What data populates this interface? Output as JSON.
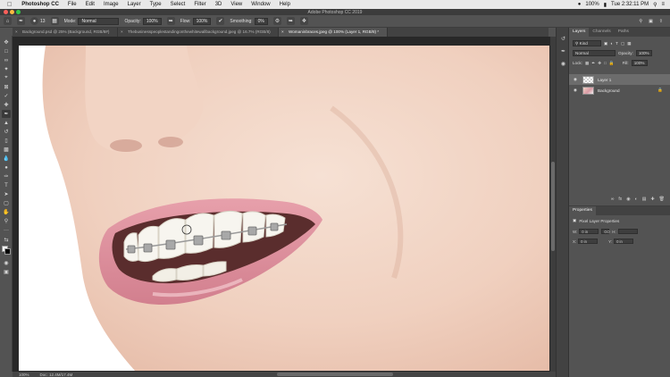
{
  "menubar": {
    "apple": "",
    "app_name": "Photoshop CC",
    "items": [
      "File",
      "Edit",
      "Image",
      "Layer",
      "Type",
      "Select",
      "Filter",
      "3D",
      "View",
      "Window",
      "Help"
    ],
    "battery": "100%",
    "clock": "Tue 2:32:11 PM"
  },
  "window": {
    "title": "Adobe Photoshop CC 2019"
  },
  "options": {
    "mode_label": "Mode:",
    "mode_value": "Normal",
    "opacity_label": "Opacity:",
    "opacity_value": "100%",
    "flow_label": "Flow:",
    "flow_value": "100%",
    "smoothing_label": "Smoothing:",
    "smoothing_value": "0%",
    "brush_size": "13"
  },
  "tabs": [
    {
      "label": "Background.psd @ 25% (Background, RGB/8#)",
      "active": false
    },
    {
      "label": "Thebusinesspeoplestandingonthewhitewallbackground.jpeg @ 16.7% (RGB/8)",
      "active": false
    },
    {
      "label": "Womaninbraces.jpeg @ 100% (Layer 1, RGB/8) *",
      "active": true
    }
  ],
  "status": {
    "zoom": "100%",
    "doc": "Doc: 12.4M/17.4M"
  },
  "layers_panel": {
    "tabs": [
      "Layers",
      "Channels",
      "Paths"
    ],
    "kind_label": "Kind",
    "blend_mode": "Normal",
    "opacity_label": "Opacity:",
    "opacity_value": "100%",
    "lock_label": "Lock:",
    "fill_label": "Fill:",
    "fill_value": "100%",
    "layers": [
      {
        "name": "Layer 1",
        "selected": true
      },
      {
        "name": "Background",
        "selected": false
      }
    ]
  },
  "properties_panel": {
    "title": "Properties",
    "subtitle": "Pixel Layer Properties",
    "w_label": "W:",
    "w_value": "0 in",
    "h_label": "H:",
    "h_value": "",
    "go_label": "GO",
    "x_label": "X:",
    "x_value": "0 in",
    "y_label": "Y:",
    "y_value": "0 in"
  },
  "colors": {
    "ui_bg": "#535353",
    "panel_dark": "#424242",
    "menubar": "#e8e8e8",
    "selected_layer": "#6c6c6c"
  }
}
